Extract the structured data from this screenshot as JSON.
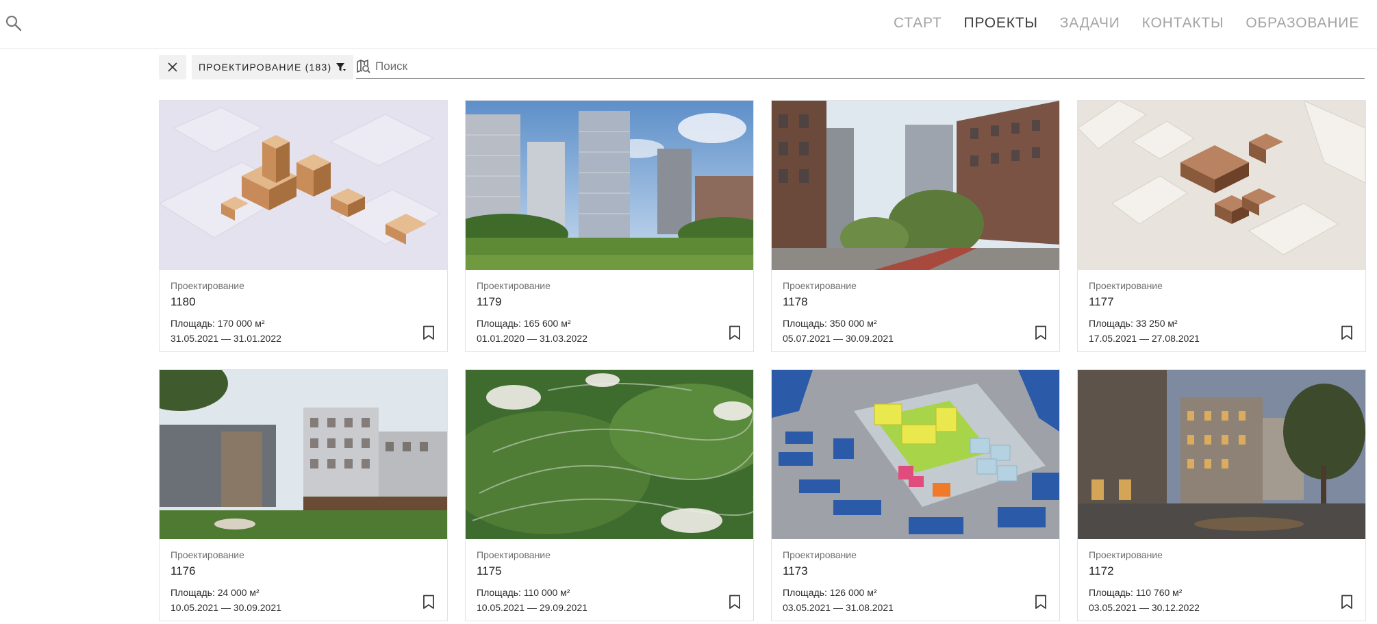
{
  "nav": {
    "items": [
      {
        "label": "СТАРТ",
        "active": false
      },
      {
        "label": "ПРОЕКТЫ",
        "active": true
      },
      {
        "label": "ЗАДАЧИ",
        "active": false
      },
      {
        "label": "КОНТАКТЫ",
        "active": false
      },
      {
        "label": "ОБРАЗОВАНИЕ",
        "active": false
      }
    ]
  },
  "header": {
    "search_icon": "search-icon"
  },
  "filter": {
    "chip_label": "ПРОЕКТИРОВАНИЕ (183)",
    "chip_icon": "filter-icon",
    "clear_icon": "close-icon",
    "search_placeholder": "Поиск",
    "search_value": "",
    "search_icon": "map-search-icon"
  },
  "cards": [
    {
      "category": "Проектирование",
      "number": "1180",
      "area": "Площадь: 170 000 м²",
      "dates": "31.05.2021 — 31.01.2022",
      "image": "model-city-blocks"
    },
    {
      "category": "Проектирование",
      "number": "1179",
      "area": "Площадь: 165 600 м²",
      "dates": "01.01.2020 — 31.03.2022",
      "image": "residential-towers"
    },
    {
      "category": "Проектирование",
      "number": "1178",
      "area": "Площадь: 350 000 м²",
      "dates": "05.07.2021 — 30.09.2021",
      "image": "street-view"
    },
    {
      "category": "Проектирование",
      "number": "1177",
      "area": "Площадь: 33 250 м²",
      "dates": "17.05.2021 — 27.08.2021",
      "image": "model-white-blocks"
    },
    {
      "category": "Проектирование",
      "number": "1176",
      "area": "Площадь: 24 000 м²",
      "dates": "10.05.2021 — 30.09.2021",
      "image": "apartment-blocks-park"
    },
    {
      "category": "Проектирование",
      "number": "1175",
      "area": "Площадь: 110 000 м²",
      "dates": "10.05.2021 — 29.09.2021",
      "image": "aerial-forest-settlement"
    },
    {
      "category": "Проектирование",
      "number": "1173",
      "area": "Площадь: 126 000 м²",
      "dates": "03.05.2021 — 31.08.2021",
      "image": "colored-site-plan"
    },
    {
      "category": "Проектирование",
      "number": "1172",
      "area": "Площадь: 110 760 м²",
      "dates": "03.05.2021 — 30.12.2022",
      "image": "evening-street"
    }
  ],
  "colors": {
    "nav_active": "#3a3a3a",
    "nav_inactive": "#a4a4a4",
    "chip_bg": "#f1f1f1"
  }
}
